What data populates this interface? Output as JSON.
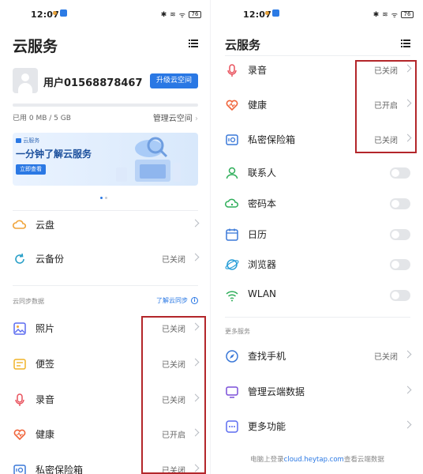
{
  "status": {
    "time": "12:07",
    "signal": "ᯤ",
    "battery": "76"
  },
  "left": {
    "title": "云服务",
    "username": "用户01568878467",
    "upgrade_label": "升级云空间",
    "storage_used": "已用 0 MB / 5 GB",
    "storage_fraction": 0.0,
    "manage_label": "管理云空间",
    "banner": {
      "brand": "云服务",
      "title": "一分钟了解云服务",
      "button": "立即查看"
    },
    "cloud_disk": "云盘",
    "cloud_backup": "云备份",
    "cloud_backup_status": "已关闭",
    "sync_section": "云同步数据",
    "sync_link": "了解云同步",
    "items": [
      {
        "label": "照片",
        "status": "已关闭",
        "icon": "photo-icon"
      },
      {
        "label": "便签",
        "status": "已关闭",
        "icon": "note-icon"
      },
      {
        "label": "录音",
        "status": "已关闭",
        "icon": "mic-icon"
      },
      {
        "label": "健康",
        "status": "已开启",
        "icon": "heart-icon"
      },
      {
        "label": "私密保险箱",
        "status": "已关闭",
        "icon": "safe-icon"
      }
    ]
  },
  "right": {
    "title": "云服务",
    "items": [
      {
        "label": "录音",
        "status": "已关闭",
        "icon": "mic-icon"
      },
      {
        "label": "健康",
        "status": "已开启",
        "icon": "heart-icon"
      },
      {
        "label": "私密保险箱",
        "status": "已关闭",
        "icon": "safe-icon"
      }
    ],
    "toggles": [
      {
        "label": "联系人",
        "icon": "contact-icon"
      },
      {
        "label": "密码本",
        "icon": "key-icon"
      },
      {
        "label": "日历",
        "icon": "calendar-icon"
      },
      {
        "label": "浏览器",
        "icon": "browser-icon"
      },
      {
        "label": "WLAN",
        "icon": "wifi-icon"
      }
    ],
    "more_section": "更多服务",
    "find_phone": "查找手机",
    "find_phone_status": "已关闭",
    "manage_data": "管理云端数据",
    "more_features": "更多功能",
    "footer_prefix": "电脑上登录",
    "footer_link": "cloud.heytap.com",
    "footer_suffix": "查看云端数据"
  },
  "colors": {
    "accent": "#2a78e4",
    "highlight": "#b3262a"
  }
}
